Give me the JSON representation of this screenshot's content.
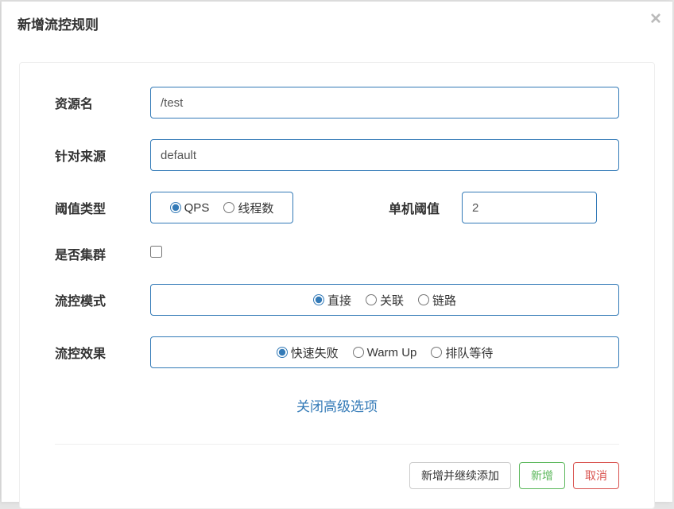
{
  "modal": {
    "title": "新增流控规则",
    "close": "×"
  },
  "form": {
    "resource": {
      "label": "资源名",
      "value": "/test"
    },
    "source": {
      "label": "针对来源",
      "value": "default"
    },
    "thresholdType": {
      "label": "阈值类型",
      "options": {
        "qps": "QPS",
        "thread": "线程数"
      },
      "selected": "qps"
    },
    "threshold": {
      "label": "单机阈值",
      "value": "2"
    },
    "cluster": {
      "label": "是否集群",
      "checked": false
    },
    "mode": {
      "label": "流控模式",
      "options": {
        "direct": "直接",
        "relate": "关联",
        "chain": "链路"
      },
      "selected": "direct"
    },
    "effect": {
      "label": "流控效果",
      "options": {
        "fail": "快速失败",
        "warmup": "Warm Up",
        "queue": "排队等待"
      },
      "selected": "fail"
    },
    "advLink": "关闭高级选项"
  },
  "footer": {
    "addContinue": "新增并继续添加",
    "add": "新增",
    "cancel": "取消"
  }
}
